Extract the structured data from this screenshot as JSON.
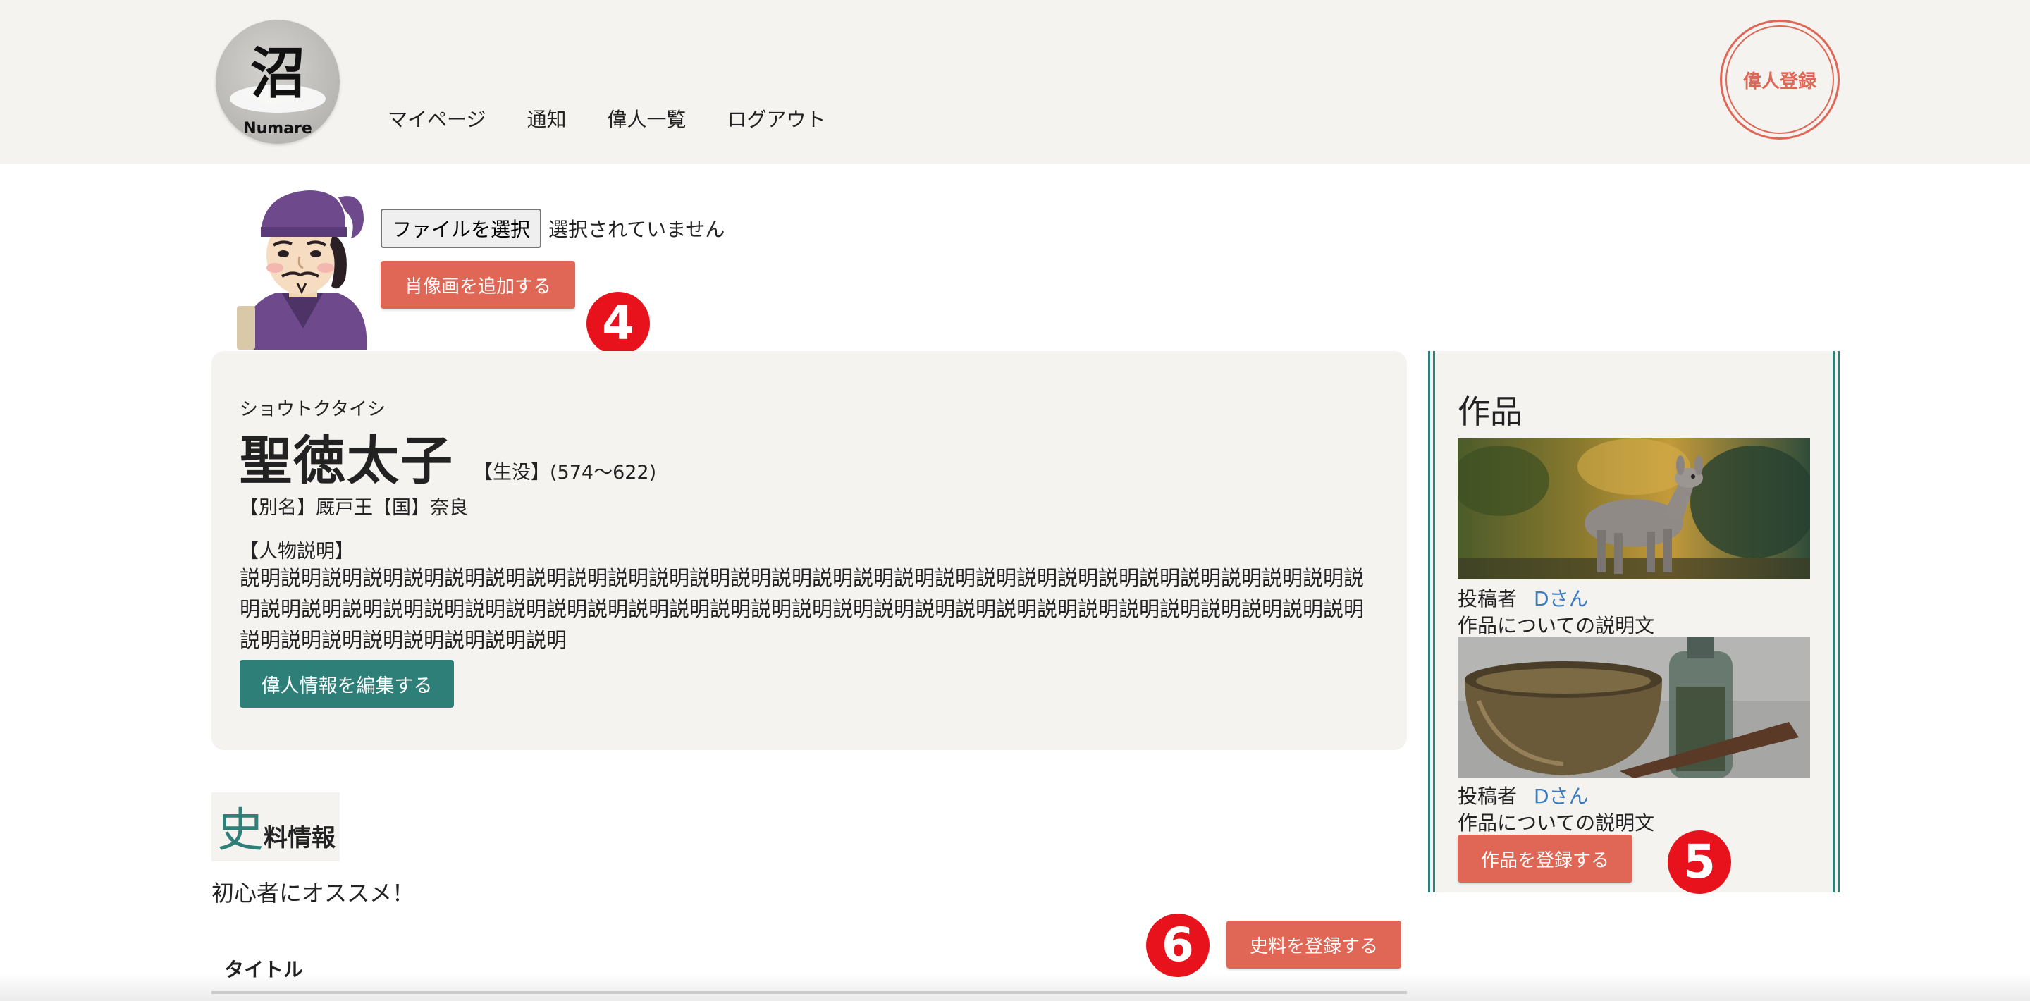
{
  "header": {
    "logo_kanji": "沼",
    "logo_brand": "Numare",
    "nav": [
      "マイページ",
      "通知",
      "偉人一覧",
      "ログアウト"
    ],
    "register_label": "偉人登録"
  },
  "portrait": {
    "file_button": "ファイルを選択",
    "file_status": "選択されていません",
    "add_button": "肖像画を追加する",
    "marker": "4"
  },
  "person": {
    "reading": "ショウトクタイシ",
    "name": "聖徳太子",
    "lifespan": "【生没】(574〜622)",
    "alias": "【別名】厩戸王【国】奈良",
    "description_label": "【人物説明】",
    "description": "説明説明説明説明説明説明説明説明説明説明説明説明説明説明説明説明説明説明説明説明説明説明説明説明説明説明説明説明説明説明説明説明説明説明説明説明説明説明説明説明説明説明説明説明説明説明説明説明説明説明説明説明説明説明説明説明説明説明説明説明説明説明説明",
    "edit_button": "偉人情報を編集する"
  },
  "works": {
    "title": "作品",
    "items": [
      {
        "poster_label": "投稿者",
        "poster_name": "Dさん",
        "description": "作品についての説明文",
        "image": "deer-photo"
      },
      {
        "poster_label": "投稿者",
        "poster_name": "Dさん",
        "description": "作品についての説明文",
        "image": "bowl-and-bottle-photo"
      }
    ],
    "register_button": "作品を登録する",
    "marker": "5"
  },
  "materials": {
    "heading_big": "史",
    "heading_rest": "料情報",
    "beginner_label": "初心者にオススメ！",
    "register_button": "史料を登録する",
    "marker": "6",
    "table_header": "タイトル"
  },
  "colors": {
    "header_bg": "#f4f3f0",
    "coral": "#e06655",
    "teal": "#2f7f79",
    "link_blue": "#3a7ac0",
    "marker_red": "#e8121c"
  }
}
